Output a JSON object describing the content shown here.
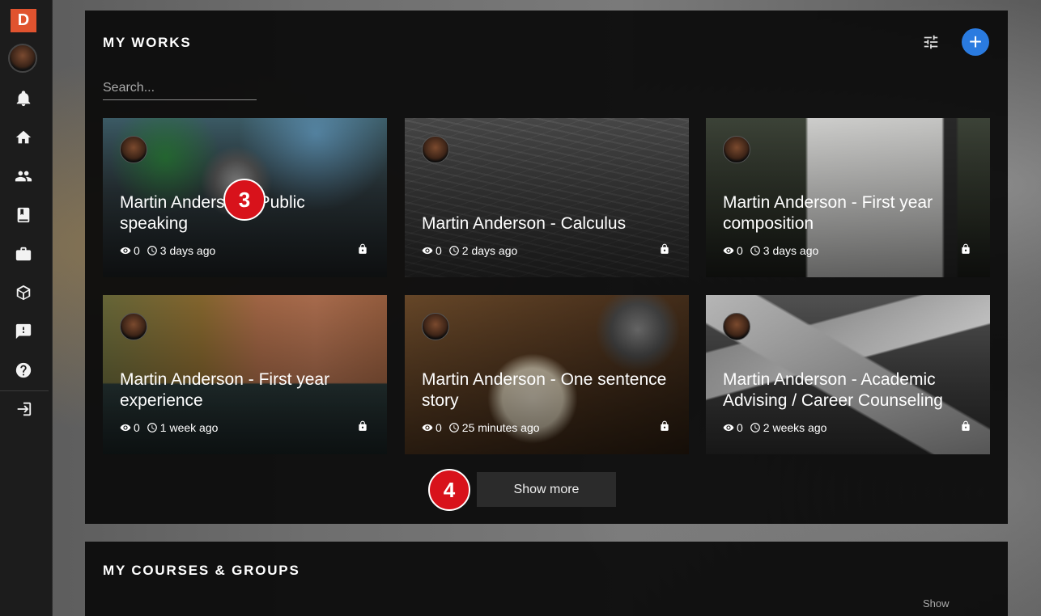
{
  "sidebar": {
    "logo_letter": "D",
    "icons": [
      "bell-icon",
      "home-icon",
      "people-icon",
      "book-icon",
      "briefcase-icon",
      "cube-icon",
      "feedback-icon",
      "help-icon",
      "logout-icon"
    ]
  },
  "works": {
    "title": "MY WORKS",
    "search_placeholder": "Search...",
    "show_more_label": "Show more",
    "cards": [
      {
        "title": "Martin Anderson - Public speaking",
        "views": "0",
        "time": "3 days ago"
      },
      {
        "title": "Martin Anderson - Calculus",
        "views": "0",
        "time": "2 days ago"
      },
      {
        "title": "Martin Anderson - First year composition",
        "views": "0",
        "time": "3 days ago"
      },
      {
        "title": "Martin Anderson - First year experience",
        "views": "0",
        "time": "1 week ago"
      },
      {
        "title": "Martin Anderson - One sentence story",
        "views": "0",
        "time": "25 minutes ago"
      },
      {
        "title": "Martin Anderson - Academic Advising / Career Counseling",
        "views": "0",
        "time": "2 weeks ago"
      }
    ]
  },
  "annotations": {
    "badge_3": "3",
    "badge_4": "4"
  },
  "courses": {
    "title": "MY COURSES & GROUPS",
    "show_label": "Show"
  },
  "colors": {
    "accent_blue": "#2a7be0",
    "logo_orange": "#e0532f",
    "badge_red": "#d8121b"
  }
}
